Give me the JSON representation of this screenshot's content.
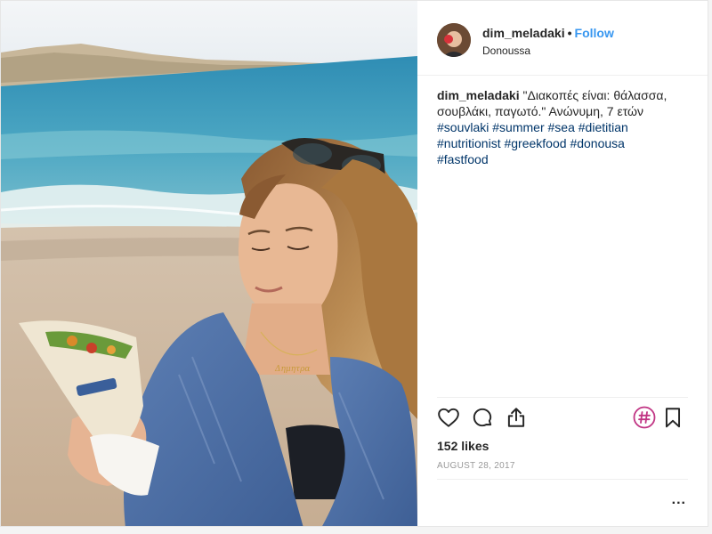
{
  "post": {
    "username": "dim_meladaki",
    "separator": "•",
    "follow_label": "Follow",
    "location": "Donoussa",
    "caption": {
      "username": "dim_meladaki",
      "text": "\"Διακοπές είναι: θάλασσα, σουβλάκι, παγωτό.\" Ανώνυμη, 7 ετών",
      "hashtags": [
        "#souvlaki",
        "#summer",
        "#sea",
        "#dietitian",
        "#nutritionist",
        "#greekfood",
        "#donousa",
        "#fastfood"
      ]
    },
    "likes": "152 likes",
    "date": "AUGUST 28, 2017",
    "more_label": "..."
  },
  "photo": {
    "necklace_text": "Δημητρα"
  },
  "icons": {
    "like": "heart-icon",
    "comment": "comment-icon",
    "share": "share-icon",
    "hashtag": "hashtag-icon",
    "save": "bookmark-icon"
  },
  "colors": {
    "link": "#3897f0",
    "hashtag": "#003569",
    "text": "#262626",
    "muted": "#999999",
    "hashtag_icon": "#c13584"
  }
}
